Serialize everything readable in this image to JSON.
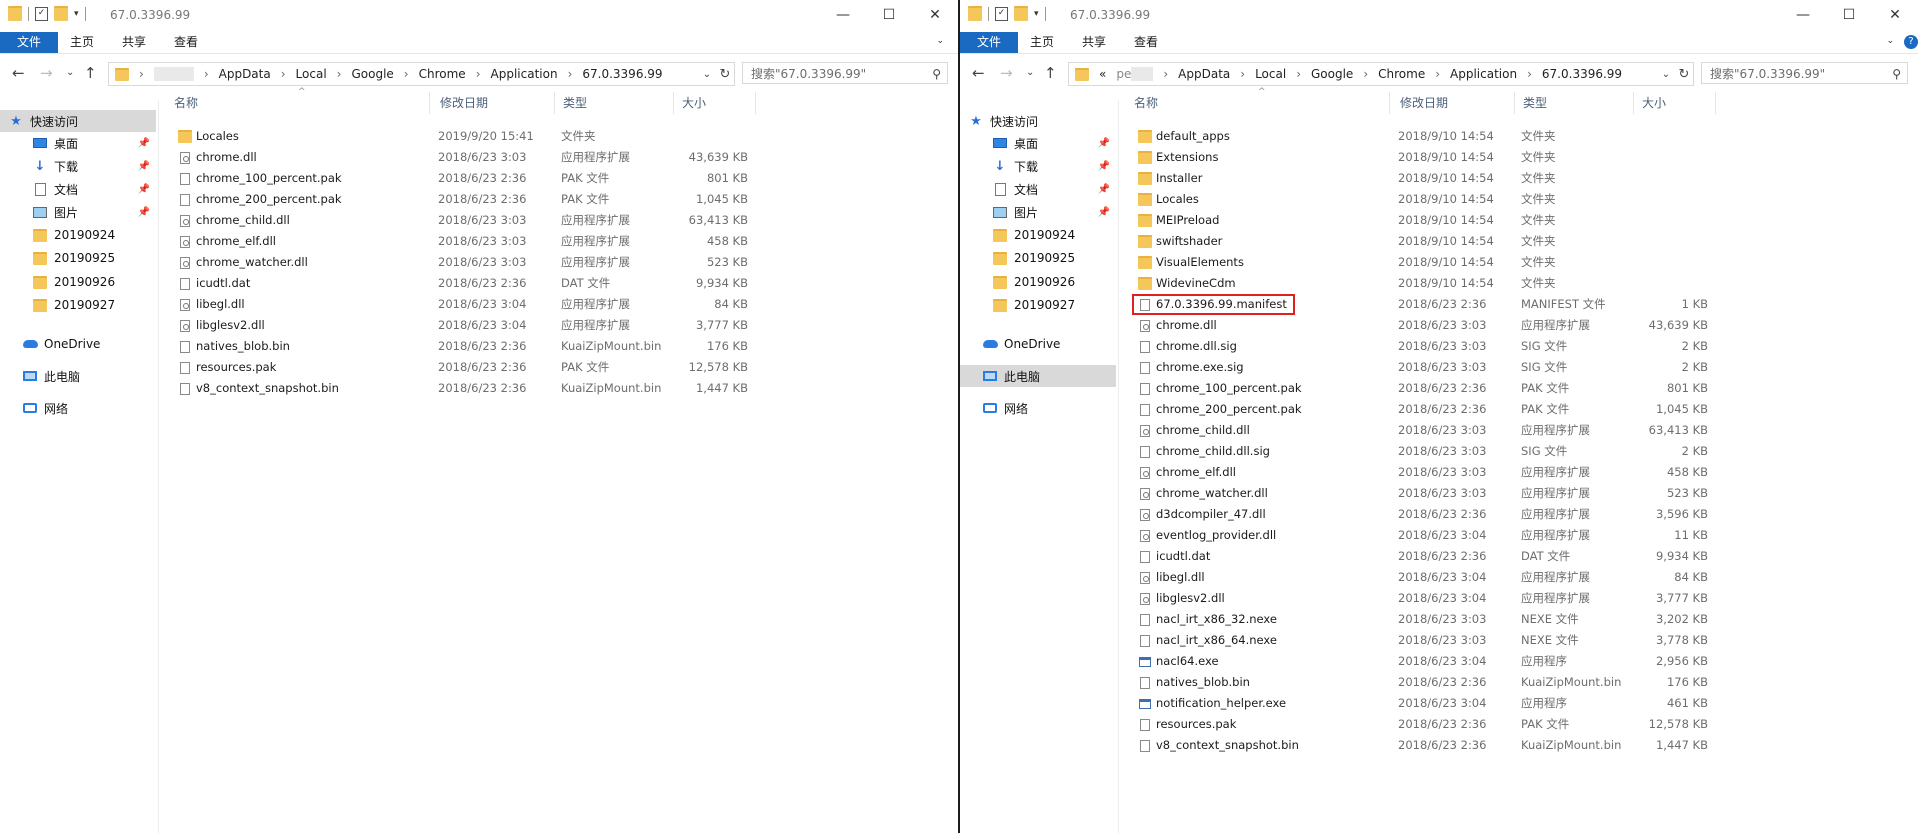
{
  "window_title": "67.0.3396.99",
  "ribbon_tabs": [
    "文件",
    "主页",
    "共享",
    "查看"
  ],
  "window_controls": {
    "minimize": "—",
    "maximize": "☐",
    "close": "✕"
  },
  "ribbon_expand": "⌄",
  "help": "?",
  "nav_icons": {
    "back": "←",
    "forward": "→",
    "history": "⌄",
    "up": "↑",
    "refresh": "↻",
    "dropdown": "⌄",
    "search": "⚲"
  },
  "column_headers": {
    "name": "名称",
    "date": "修改日期",
    "type": "类型",
    "size": "大小"
  },
  "sidebar": {
    "quick_access": "快速访问",
    "items": [
      "桌面",
      "下载",
      "文档",
      "图片",
      "20190924",
      "20190925",
      "20190926",
      "20190927"
    ],
    "onedrive": "OneDrive",
    "this_pc": "此电脑",
    "network": "网络"
  },
  "left": {
    "breadcrumbs": [
      "AppData",
      "Local",
      "Google",
      "Chrome",
      "Application",
      "67.0.3396.99"
    ],
    "search_placeholder": "搜索\"67.0.3396.99\"",
    "files": [
      {
        "name": "Locales",
        "date": "2019/9/20 15:41",
        "type": "文件夹",
        "size": "",
        "icon": "folder"
      },
      {
        "name": "chrome.dll",
        "date": "2018/6/23 3:03",
        "type": "应用程序扩展",
        "size": "43,639 KB",
        "icon": "dll"
      },
      {
        "name": "chrome_100_percent.pak",
        "date": "2018/6/23 2:36",
        "type": "PAK 文件",
        "size": "801 KB",
        "icon": "file"
      },
      {
        "name": "chrome_200_percent.pak",
        "date": "2018/6/23 2:36",
        "type": "PAK 文件",
        "size": "1,045 KB",
        "icon": "file"
      },
      {
        "name": "chrome_child.dll",
        "date": "2018/6/23 3:03",
        "type": "应用程序扩展",
        "size": "63,413 KB",
        "icon": "dll"
      },
      {
        "name": "chrome_elf.dll",
        "date": "2018/6/23 3:03",
        "type": "应用程序扩展",
        "size": "458 KB",
        "icon": "dll"
      },
      {
        "name": "chrome_watcher.dll",
        "date": "2018/6/23 3:03",
        "type": "应用程序扩展",
        "size": "523 KB",
        "icon": "dll"
      },
      {
        "name": "icudtl.dat",
        "date": "2018/6/23 2:36",
        "type": "DAT 文件",
        "size": "9,934 KB",
        "icon": "file"
      },
      {
        "name": "libegl.dll",
        "date": "2018/6/23 3:04",
        "type": "应用程序扩展",
        "size": "84 KB",
        "icon": "dll"
      },
      {
        "name": "libglesv2.dll",
        "date": "2018/6/23 3:04",
        "type": "应用程序扩展",
        "size": "3,777 KB",
        "icon": "dll"
      },
      {
        "name": "natives_blob.bin",
        "date": "2018/6/23 2:36",
        "type": "KuaiZipMount.bin",
        "size": "176 KB",
        "icon": "file"
      },
      {
        "name": "resources.pak",
        "date": "2018/6/23 2:36",
        "type": "PAK 文件",
        "size": "12,578 KB",
        "icon": "file"
      },
      {
        "name": "v8_context_snapshot.bin",
        "date": "2018/6/23 2:36",
        "type": "KuaiZipMount.bin",
        "size": "1,447 KB",
        "icon": "file"
      }
    ]
  },
  "right": {
    "breadcrumb_prefix": "«",
    "breadcrumb_partial": "pe",
    "breadcrumbs": [
      "AppData",
      "Local",
      "Google",
      "Chrome",
      "Application",
      "67.0.3396.99"
    ],
    "search_placeholder": "搜索\"67.0.3396.99\"",
    "files": [
      {
        "name": "default_apps",
        "date": "2018/9/10 14:54",
        "type": "文件夹",
        "size": "",
        "icon": "folder"
      },
      {
        "name": "Extensions",
        "date": "2018/9/10 14:54",
        "type": "文件夹",
        "size": "",
        "icon": "folder"
      },
      {
        "name": "Installer",
        "date": "2018/9/10 14:54",
        "type": "文件夹",
        "size": "",
        "icon": "folder"
      },
      {
        "name": "Locales",
        "date": "2018/9/10 14:54",
        "type": "文件夹",
        "size": "",
        "icon": "folder"
      },
      {
        "name": "MEIPreload",
        "date": "2018/9/10 14:54",
        "type": "文件夹",
        "size": "",
        "icon": "folder"
      },
      {
        "name": "swiftshader",
        "date": "2018/9/10 14:54",
        "type": "文件夹",
        "size": "",
        "icon": "folder"
      },
      {
        "name": "VisualElements",
        "date": "2018/9/10 14:54",
        "type": "文件夹",
        "size": "",
        "icon": "folder"
      },
      {
        "name": "WidevineCdm",
        "date": "2018/9/10 14:54",
        "type": "文件夹",
        "size": "",
        "icon": "folder"
      },
      {
        "name": "67.0.3396.99.manifest",
        "date": "2018/6/23 2:36",
        "type": "MANIFEST 文件",
        "size": "1 KB",
        "icon": "file",
        "highlight": true
      },
      {
        "name": "chrome.dll",
        "date": "2018/6/23 3:03",
        "type": "应用程序扩展",
        "size": "43,639 KB",
        "icon": "dll"
      },
      {
        "name": "chrome.dll.sig",
        "date": "2018/6/23 3:03",
        "type": "SIG 文件",
        "size": "2 KB",
        "icon": "file"
      },
      {
        "name": "chrome.exe.sig",
        "date": "2018/6/23 3:03",
        "type": "SIG 文件",
        "size": "2 KB",
        "icon": "file"
      },
      {
        "name": "chrome_100_percent.pak",
        "date": "2018/6/23 2:36",
        "type": "PAK 文件",
        "size": "801 KB",
        "icon": "file"
      },
      {
        "name": "chrome_200_percent.pak",
        "date": "2018/6/23 2:36",
        "type": "PAK 文件",
        "size": "1,045 KB",
        "icon": "file"
      },
      {
        "name": "chrome_child.dll",
        "date": "2018/6/23 3:03",
        "type": "应用程序扩展",
        "size": "63,413 KB",
        "icon": "dll"
      },
      {
        "name": "chrome_child.dll.sig",
        "date": "2018/6/23 3:03",
        "type": "SIG 文件",
        "size": "2 KB",
        "icon": "file"
      },
      {
        "name": "chrome_elf.dll",
        "date": "2018/6/23 3:03",
        "type": "应用程序扩展",
        "size": "458 KB",
        "icon": "dll"
      },
      {
        "name": "chrome_watcher.dll",
        "date": "2018/6/23 3:03",
        "type": "应用程序扩展",
        "size": "523 KB",
        "icon": "dll"
      },
      {
        "name": "d3dcompiler_47.dll",
        "date": "2018/6/23 2:36",
        "type": "应用程序扩展",
        "size": "3,596 KB",
        "icon": "dll"
      },
      {
        "name": "eventlog_provider.dll",
        "date": "2018/6/23 3:04",
        "type": "应用程序扩展",
        "size": "11 KB",
        "icon": "dll"
      },
      {
        "name": "icudtl.dat",
        "date": "2018/6/23 2:36",
        "type": "DAT 文件",
        "size": "9,934 KB",
        "icon": "file"
      },
      {
        "name": "libegl.dll",
        "date": "2018/6/23 3:04",
        "type": "应用程序扩展",
        "size": "84 KB",
        "icon": "dll"
      },
      {
        "name": "libglesv2.dll",
        "date": "2018/6/23 3:04",
        "type": "应用程序扩展",
        "size": "3,777 KB",
        "icon": "dll"
      },
      {
        "name": "nacl_irt_x86_32.nexe",
        "date": "2018/6/23 3:03",
        "type": "NEXE 文件",
        "size": "3,202 KB",
        "icon": "file"
      },
      {
        "name": "nacl_irt_x86_64.nexe",
        "date": "2018/6/23 3:03",
        "type": "NEXE 文件",
        "size": "3,778 KB",
        "icon": "file"
      },
      {
        "name": "nacl64.exe",
        "date": "2018/6/23 3:04",
        "type": "应用程序",
        "size": "2,956 KB",
        "icon": "exe"
      },
      {
        "name": "natives_blob.bin",
        "date": "2018/6/23 2:36",
        "type": "KuaiZipMount.bin",
        "size": "176 KB",
        "icon": "file"
      },
      {
        "name": "notification_helper.exe",
        "date": "2018/6/23 3:04",
        "type": "应用程序",
        "size": "461 KB",
        "icon": "exe"
      },
      {
        "name": "resources.pak",
        "date": "2018/6/23 2:36",
        "type": "PAK 文件",
        "size": "12,578 KB",
        "icon": "file"
      },
      {
        "name": "v8_context_snapshot.bin",
        "date": "2018/6/23 2:36",
        "type": "KuaiZipMount.bin",
        "size": "1,447 KB",
        "icon": "file"
      }
    ]
  }
}
